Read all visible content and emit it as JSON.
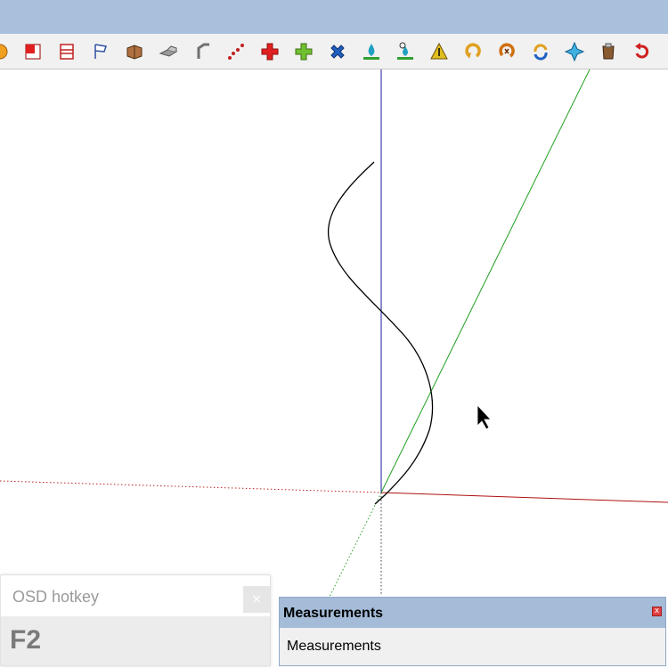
{
  "toolbar": {
    "tools": [
      {
        "name": "orange-circle-icon",
        "color": "#f0a020"
      },
      {
        "name": "red-square-icon",
        "color": "#e02020"
      },
      {
        "name": "section-plane-icon",
        "color": "#c02020"
      },
      {
        "name": "flag-icon",
        "color": "#3050a0"
      },
      {
        "name": "box-icon",
        "color": "#a06030"
      },
      {
        "name": "extrude-icon",
        "color": "#707070"
      },
      {
        "name": "follow-me-icon",
        "color": "#707070"
      },
      {
        "name": "dots-path-icon",
        "color": "#c02020"
      },
      {
        "name": "red-cross-icon",
        "color": "#e02020"
      },
      {
        "name": "green-cross-icon",
        "color": "#60b020"
      },
      {
        "name": "blue-x-icon",
        "color": "#2060c0"
      },
      {
        "name": "water-drop-icon",
        "color": "#20a0c0"
      },
      {
        "name": "drop-gear-icon",
        "color": "#20a0c0"
      },
      {
        "name": "warning-triangle-icon",
        "color": "#e0b020"
      },
      {
        "name": "rotate-yellow-icon",
        "color": "#e0a020"
      },
      {
        "name": "rotate-orange-icon",
        "color": "#d07010"
      },
      {
        "name": "rotate-arrows-icon",
        "color": "#2060c0"
      },
      {
        "name": "move-star-icon",
        "color": "#20a0d0"
      },
      {
        "name": "paste-box-icon",
        "color": "#805030"
      },
      {
        "name": "undo-red-icon",
        "color": "#d02020"
      }
    ]
  },
  "osd": {
    "title": "OSD hotkey",
    "close": "×",
    "key": "F2"
  },
  "measurements": {
    "title": "Measurements",
    "label": "Measurements",
    "close": "x"
  },
  "colors": {
    "blue_axis": "#1a1aa0",
    "green_axis": "#20a020",
    "red_axis": "#b01010",
    "curve": "#000000"
  }
}
